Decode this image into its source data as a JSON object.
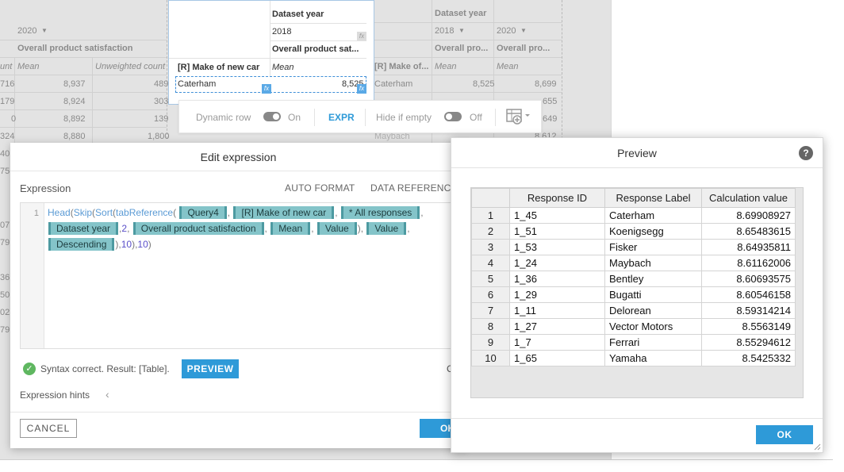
{
  "background": {
    "cols_left": {
      "year": "2020",
      "measure": "Overall product satisfaction",
      "count_label": "unt",
      "mean_label": "Mean",
      "unweighted_label": "Unweighted count",
      "left_values": [
        "716",
        "179",
        "0",
        "324",
        "40",
        "75",
        "07",
        "79",
        "36",
        "50",
        "02",
        "79"
      ],
      "mean_values": [
        "8,937",
        "8,924",
        "8,892",
        "8,880"
      ],
      "unweighted_values": [
        "489",
        "303",
        "139",
        "1,800"
      ]
    },
    "cols_right": {
      "dataset_year": "Dataset year",
      "year1": "2018",
      "year2": "2020",
      "measure1": "Overall pro...",
      "measure2": "Overall pro...",
      "make_label": "[R] Make of...",
      "mean1": "Mean",
      "mean2": "Mean",
      "row_label": "Caterham",
      "row_v1": "8,525",
      "row_v2": "8,699",
      "v_a": "655",
      "v_b": "649",
      "row_faded": "Maybach",
      "v_c": "8,612"
    },
    "card": {
      "dataset_year": "Dataset year",
      "year": "2018",
      "measure": "Overall product sat...",
      "make_label": "[R] Make of new car",
      "mean": "Mean",
      "row_label": "Caterham",
      "row_value": "8,525",
      "fx": "fx"
    },
    "toolbar": {
      "dynamic_row": "Dynamic row",
      "dynamic_state": "On",
      "expr": "EXPR",
      "hide_empty": "Hide if empty",
      "hide_state": "Off"
    }
  },
  "edit_dialog": {
    "title": "Edit expression",
    "expression_label": "Expression",
    "auto_format": "AUTO FORMAT",
    "data_references": "DATA REFERENCES",
    "line_number": "1",
    "code": {
      "head": "Head",
      "skip": "Skip",
      "sort": "Sort",
      "tabref": "tabReference",
      "query": "Query4",
      "make": "[R] Make of new car",
      "responses": "* All responses",
      "dataset_year": "Dataset year",
      "measure": "Overall product satisfaction",
      "mean": "Mean",
      "value1": "Value",
      "value2": "Value",
      "descending": "Descending",
      "num2": "2",
      "num10a": "10",
      "num10b": "10"
    },
    "syntax_status": "Syntax correct. Result: [Table].",
    "preview_button": "PREVIEW",
    "hints": "Expression hints",
    "cancel": "CANCEL",
    "ok": "OK",
    "status_cut": "C"
  },
  "preview_dialog": {
    "title": "Preview",
    "columns": [
      "Response ID",
      "Response Label",
      "Calculation value"
    ],
    "rows": [
      {
        "n": "1",
        "id": "1_45",
        "label": "Caterham",
        "value": "8.69908927"
      },
      {
        "n": "2",
        "id": "1_51",
        "label": "Koenigsegg",
        "value": "8.65483615"
      },
      {
        "n": "3",
        "id": "1_53",
        "label": "Fisker",
        "value": "8.64935811"
      },
      {
        "n": "4",
        "id": "1_24",
        "label": "Maybach",
        "value": "8.61162006"
      },
      {
        "n": "5",
        "id": "1_36",
        "label": "Bentley",
        "value": "8.60693575"
      },
      {
        "n": "6",
        "id": "1_29",
        "label": "Bugatti",
        "value": "8.60546158"
      },
      {
        "n": "7",
        "id": "1_11",
        "label": "Delorean",
        "value": "8.59314214"
      },
      {
        "n": "8",
        "id": "1_27",
        "label": "Vector Motors",
        "value": "8.5563149"
      },
      {
        "n": "9",
        "id": "1_7",
        "label": "Ferrari",
        "value": "8.55294612"
      },
      {
        "n": "10",
        "id": "1_65",
        "label": "Yamaha",
        "value": "8.5425332"
      }
    ],
    "ok": "OK"
  }
}
